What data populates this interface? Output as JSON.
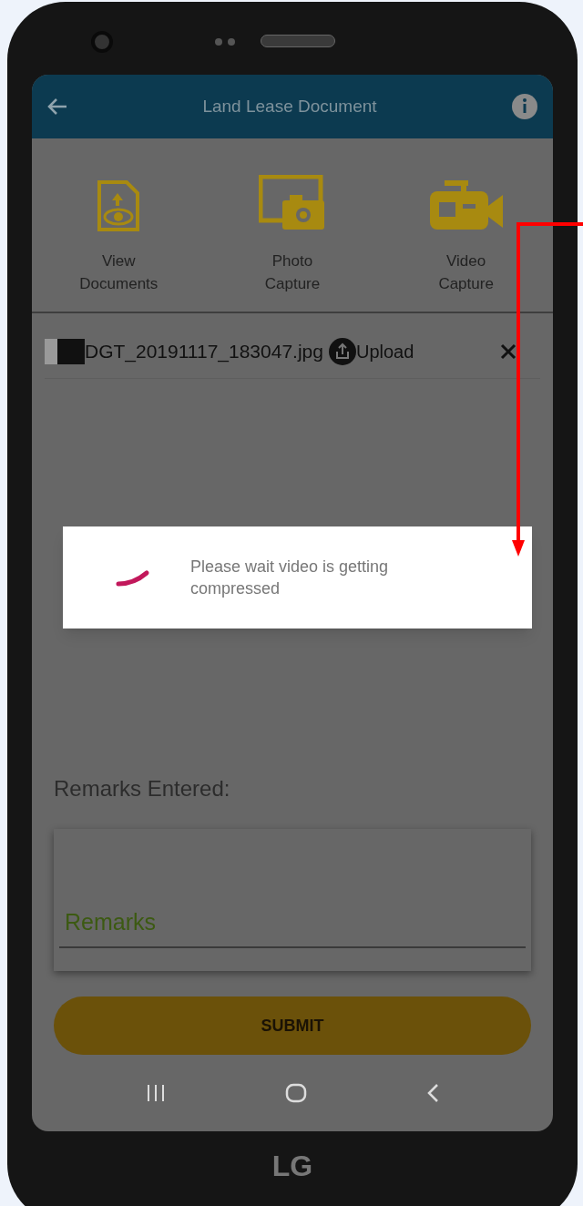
{
  "header": {
    "title": "Land Lease Document"
  },
  "actions": [
    {
      "kind": "document",
      "label": "View\nDocuments"
    },
    {
      "kind": "photo",
      "label": "Photo\nCapture"
    },
    {
      "kind": "video",
      "label": "Video\nCapture"
    }
  ],
  "files": [
    {
      "name": "DGT_20191117_183047.jpg",
      "upload": "Upload"
    }
  ],
  "dialog": {
    "message": "Please wait video is getting compressed"
  },
  "remarks": {
    "label": "Remarks Entered:",
    "placeholder": "Remarks"
  },
  "submit": "SUBMIT",
  "brand": "LG"
}
